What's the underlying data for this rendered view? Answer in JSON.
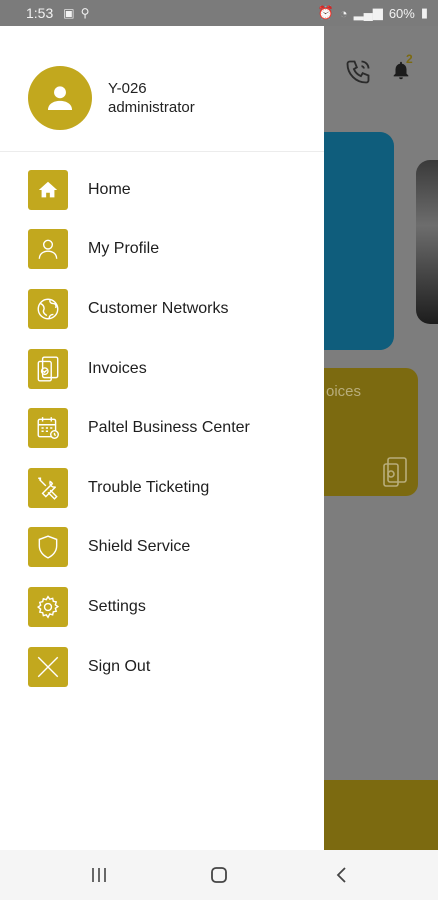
{
  "status_bar": {
    "time": "1:53",
    "battery": "60%"
  },
  "user": {
    "id": "Y-026",
    "role": "administrator"
  },
  "menu": {
    "items": [
      {
        "label": "Home",
        "icon": "home-icon"
      },
      {
        "label": "My Profile",
        "icon": "person-icon"
      },
      {
        "label": "Customer Networks",
        "icon": "globe-icon"
      },
      {
        "label": "Invoices",
        "icon": "invoice-icon"
      },
      {
        "label": "Paltel Business Center",
        "icon": "calendar-icon"
      },
      {
        "label": "Trouble Ticketing",
        "icon": "tools-icon"
      },
      {
        "label": "Shield Service",
        "icon": "shield-icon"
      },
      {
        "label": "Settings",
        "icon": "gear-icon"
      },
      {
        "label": "Sign Out",
        "icon": "close-icon"
      }
    ]
  },
  "background": {
    "notification_count": "2",
    "gold_card_text": "oices"
  },
  "colors": {
    "accent": "#c2a81e",
    "drawer_bg": "#ffffff",
    "dim_overlay": "#7d7d7d"
  }
}
